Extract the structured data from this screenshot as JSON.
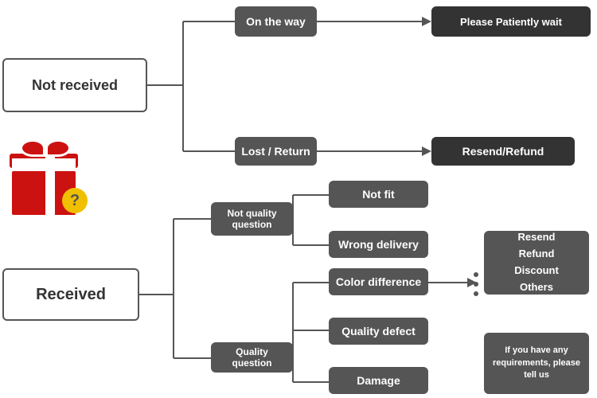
{
  "boxes": {
    "not_received": {
      "label": "Not received"
    },
    "on_the_way": {
      "label": "On the way"
    },
    "please_wait": {
      "label": "Please Patiently wait"
    },
    "lost_return": {
      "label": "Lost / Return"
    },
    "resend_refund_top": {
      "label": "Resend/Refund"
    },
    "received": {
      "label": "Received"
    },
    "not_quality": {
      "label": "Not quality question"
    },
    "quality_q": {
      "label": "Quality question"
    },
    "not_fit": {
      "label": "Not fit"
    },
    "wrong_delivery": {
      "label": "Wrong delivery"
    },
    "color_diff": {
      "label": "Color difference"
    },
    "quality_defect": {
      "label": "Quality defect"
    },
    "damage": {
      "label": "Damage"
    },
    "resend_result": {
      "label": "Resend\nRefund\nDiscount\nOthers"
    },
    "if_requirements": {
      "label": "If you have any requirements, please tell us"
    }
  }
}
